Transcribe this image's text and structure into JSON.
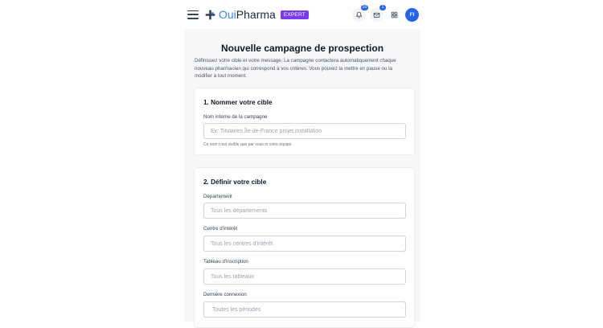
{
  "header": {
    "brand_prefix": "Oui",
    "brand_suffix": "Pharma",
    "badge": "EXPERT",
    "notifications_count": "10",
    "messages_count": "1",
    "avatar_initials": "FI",
    "accent_color": "#2563eb",
    "badge_color": "#7c3aed",
    "icons": [
      "menu-icon",
      "pharmacy-cross-icon",
      "bell-icon",
      "mail-icon",
      "grid-icon"
    ]
  },
  "page": {
    "title": "Nouvelle campagne de prospection",
    "description": "Définissez votre cible et votre message. La campagne contactera automatiquement chaque nouveau pharmacien qui correspond à vos critères. Vous pouvez la mettre en pause ou la modifier à tout moment."
  },
  "section1": {
    "heading": "1. Nommer votre cible",
    "name_label": "Nom interne de la campagne",
    "name_placeholder": "Ex: Titulaires Île-de-France projet installation",
    "name_hint": "Ce nom n'est visible que par vous et votre équipe."
  },
  "section2": {
    "heading": "2. Définir votre cible",
    "departement_label": "Département",
    "departement_value": "Tous les départements",
    "interet_label": "Centre d'intérêt",
    "interet_value": "Tous les centres d'intérêt",
    "tableau_label": "Tableau d'inscription",
    "tableau_value": "Tous les tableaux",
    "connexion_label": "Dernière connexion",
    "connexion_value": "Toutes les périodes"
  }
}
